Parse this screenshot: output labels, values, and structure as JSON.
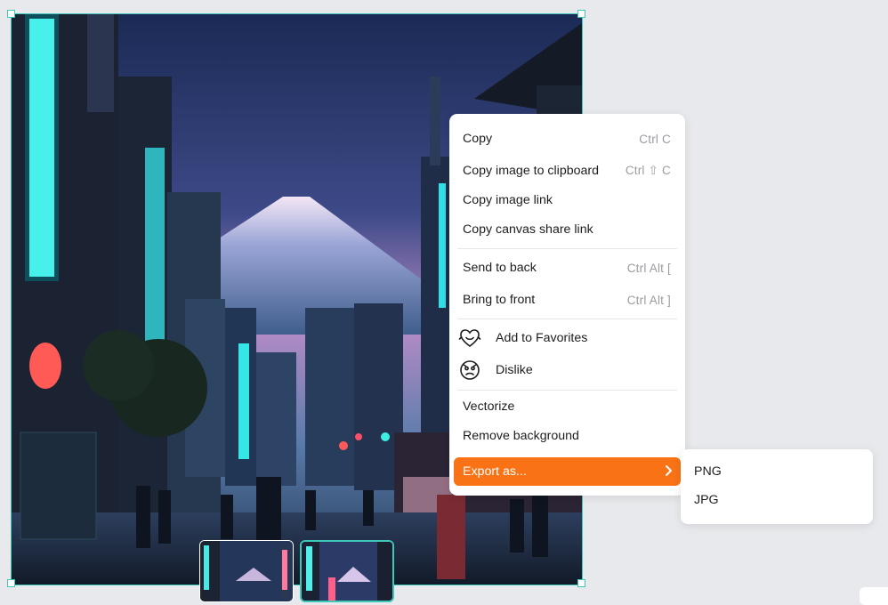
{
  "canvas": {
    "image_description_name": "neon-city-mount-fuji-image",
    "selection_color": "#3fc7b8"
  },
  "context_menu": {
    "items": [
      {
        "label": "Copy",
        "shortcut": "Ctrl C"
      },
      {
        "label": "Copy image to clipboard",
        "shortcut": "Ctrl ⇧ C"
      },
      {
        "label": "Copy image link",
        "shortcut": ""
      },
      {
        "label": "Copy canvas share link",
        "shortcut": ""
      },
      {
        "label": "Send to back",
        "shortcut": "Ctrl Alt ["
      },
      {
        "label": "Bring to front",
        "shortcut": "Ctrl Alt ]"
      },
      {
        "label": "Add to Favorites",
        "icon": "heart-smile-icon"
      },
      {
        "label": "Dislike",
        "icon": "dislike-face-icon"
      },
      {
        "label": "Vectorize"
      },
      {
        "label": "Remove background"
      },
      {
        "label": "Export as...",
        "icon": "chevron-right-icon"
      }
    ],
    "accent_color": "#f97316"
  },
  "export_submenu": {
    "items": [
      {
        "label": "PNG"
      },
      {
        "label": "JPG"
      }
    ]
  }
}
